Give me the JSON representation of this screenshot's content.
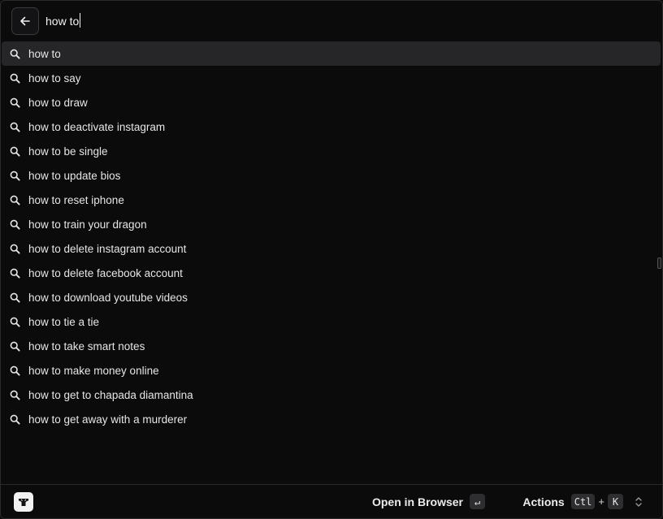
{
  "search": {
    "value": "how to",
    "back_icon": "arrow-left-icon"
  },
  "suggestions": [
    "how to",
    "how to say",
    "how to draw",
    "how to deactivate instagram",
    "how to be single",
    "how to update bios",
    "how to reset iphone",
    "how to train your dragon",
    "how to delete instagram account",
    "how to delete facebook account",
    "how to download youtube videos",
    "how to tie a tie",
    "how to take smart notes",
    "how to make money online",
    "how to get to chapada diamantina",
    "how to get away with a murderer"
  ],
  "selected_index": 0,
  "footer": {
    "primary_action": "Open in Browser",
    "primary_key": "↵",
    "actions_label": "Actions",
    "actions_mod": "Ctl",
    "actions_plus": "+",
    "actions_key": "K"
  },
  "colors": {
    "background": "#0b0b0c",
    "selected_row": "#262628",
    "text": "#e6e6e6"
  }
}
